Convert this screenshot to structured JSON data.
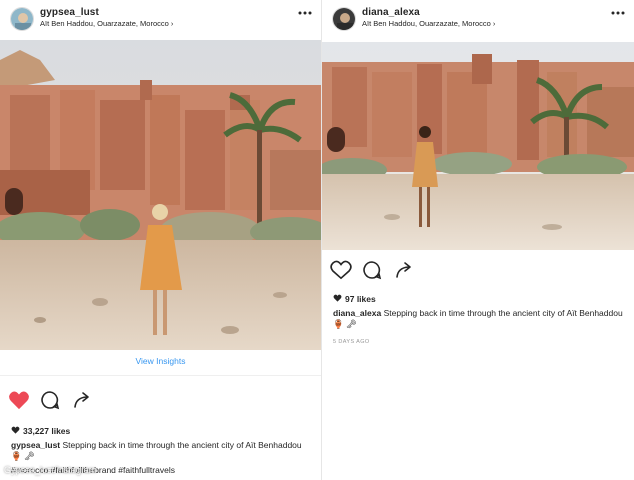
{
  "left_post": {
    "username": "gypsea_lust",
    "location": "Aït Ben Haddou, Ouarzazate, Morocco",
    "view_insights": "View Insights",
    "likes": "33,227 likes",
    "caption_user": "gypsea_lust",
    "caption_text": "Stepping back in time through the ancient city of Aït Benhaddou",
    "caption_emoji": "🏺 🗝",
    "tags": "#morocco #faithfullthebrand #faithfulltravels",
    "icons": [
      "more-icon",
      "heart-filled-icon",
      "comment-icon",
      "share-icon",
      "heart-small-icon"
    ],
    "like_color": "#ed4956"
  },
  "right_post": {
    "username": "diana_alexa",
    "location": "Aït Ben Haddou, Ouarzazate, Morocco",
    "likes": "97 likes",
    "caption_user": "diana_alexa",
    "caption_text": "Stepping back in time through the ancient city of Aït Benhaddou",
    "caption_emoji": "🏺 🗝",
    "time_ago": "5 DAYS AGO",
    "icons": [
      "more-icon",
      "heart-outline-icon",
      "comment-icon",
      "share-icon",
      "heart-small-icon"
    ]
  },
  "watermark": "Gypsea_lust/Instagram"
}
